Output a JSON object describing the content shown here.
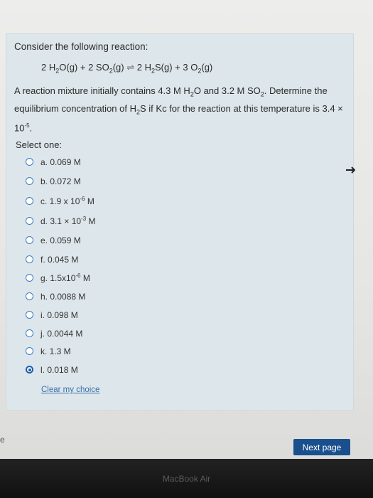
{
  "question": {
    "prompt": "Consider the following reaction:",
    "equation": {
      "lhs1": "2 H",
      "lhs1_sub": "2",
      "lhs1_tail": "O(g) + 2 SO",
      "lhs2_sub": "2",
      "lhs2_tail": "(g)",
      "arrow": "⇌",
      "rhs1": "2 H",
      "rhs1_sub": "2",
      "rhs1_tail": "S(g) + 3 O",
      "rhs2_sub": "2",
      "rhs2_tail": "(g)"
    },
    "paragraph": {
      "p1": "A reaction mixture initially contains 4.3 M H",
      "p1_sub": "2",
      "p2": "O and 3.2 M SO",
      "p2_sub": "2",
      "p3": ". Determine the equilibrium concentration of H",
      "p3_sub": "2",
      "p4": "S if Kc for the reaction at this temperature is 3.4 × 10",
      "p4_sup": "-5",
      "p5": "."
    }
  },
  "select_one_label": "Select one:",
  "options": [
    {
      "text": "a. 0.069 M",
      "sup": "",
      "tail": "",
      "checked": false
    },
    {
      "text": "b. 0.072 M",
      "sup": "",
      "tail": "",
      "checked": false
    },
    {
      "text": "c. 1.9 x 10",
      "sup": "-6",
      "tail": " M",
      "checked": false
    },
    {
      "text": "d. 3.1 × 10",
      "sup": "-3",
      "tail": " M",
      "checked": false
    },
    {
      "text": "e. 0.059 M",
      "sup": "",
      "tail": "",
      "checked": false
    },
    {
      "text": "f. 0.045 M",
      "sup": "",
      "tail": "",
      "checked": false
    },
    {
      "text": "g. 1.5x10",
      "sup": "-6",
      "tail": " M",
      "checked": false
    },
    {
      "text": "h. 0.0088 M",
      "sup": "",
      "tail": "",
      "checked": false
    },
    {
      "text": "i. 0.098 M",
      "sup": "",
      "tail": "",
      "checked": false
    },
    {
      "text": "j. 0.0044 M",
      "sup": "",
      "tail": "",
      "checked": false
    },
    {
      "text": "k. 1.3 M",
      "sup": "",
      "tail": "",
      "checked": false
    },
    {
      "text": "l. 0.018 M",
      "sup": "",
      "tail": "",
      "checked": true
    }
  ],
  "clear_choice": "Clear my choice",
  "next_button": "Next page",
  "edge_letter": "e",
  "laptop_label": "MacBook Air",
  "colors": {
    "accent": "#1a4f8e",
    "radio": "#3a7ec8",
    "link": "#3a6fb0",
    "card": "#dde6ea"
  },
  "icons": {
    "cursor": "cursor-arrow-icon"
  }
}
